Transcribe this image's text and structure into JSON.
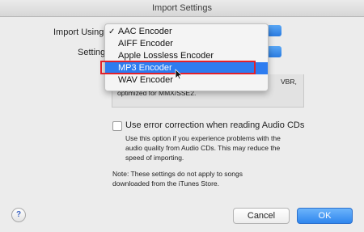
{
  "window": {
    "title": "Import Settings"
  },
  "import_using": {
    "label": "Import Using:"
  },
  "setting": {
    "label": "Setting:"
  },
  "menu": {
    "items": [
      {
        "label": "AAC Encoder",
        "checked": true,
        "highlighted": false
      },
      {
        "label": "AIFF Encoder",
        "checked": false,
        "highlighted": false
      },
      {
        "label": "Apple Lossless Encoder",
        "checked": false,
        "highlighted": false
      },
      {
        "label": "MP3 Encoder",
        "checked": false,
        "highlighted": true
      },
      {
        "label": "WAV Encoder",
        "checked": false,
        "highlighted": false
      }
    ],
    "check_glyph": "✓"
  },
  "info": {
    "line1_visible": "VBR,",
    "line2": "optimized for MMX/SSE2."
  },
  "error_correction": {
    "label": "Use error correction when reading Audio CDs",
    "checked": false,
    "help_line1": "Use this option if you experience problems with the",
    "help_line2": "audio quality from Audio CDs.  This may reduce the",
    "help_line3": "speed of importing."
  },
  "note": {
    "line1": "Note: These settings do not apply to songs",
    "line2": "downloaded from the iTunes Store."
  },
  "buttons": {
    "help": "?",
    "cancel": "Cancel",
    "ok": "OK"
  },
  "colors": {
    "accent": "#2d7cf0",
    "annotation": "#e2202a"
  }
}
